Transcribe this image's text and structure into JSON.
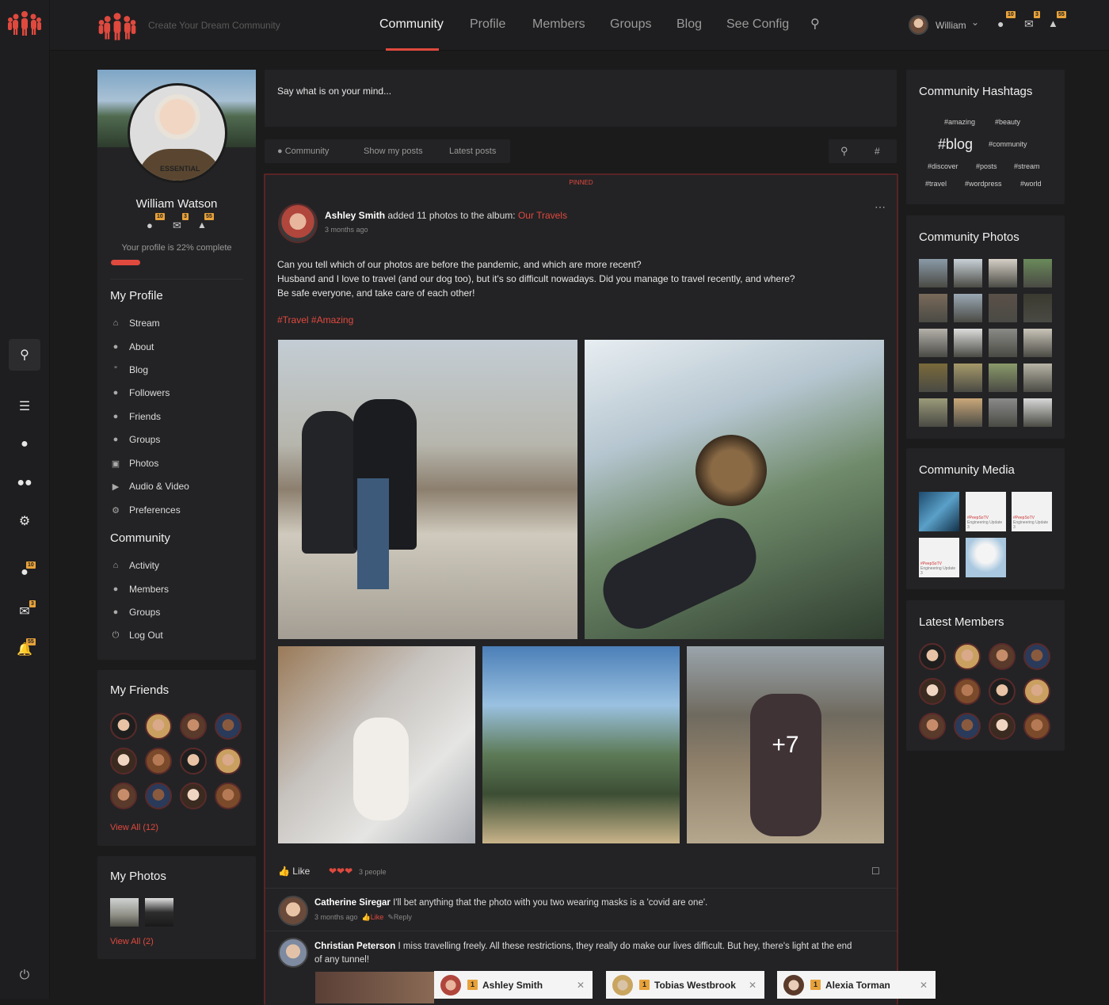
{
  "brand": {
    "tagline": "Create Your Dream Community"
  },
  "nav": [
    "Community",
    "Profile",
    "Members",
    "Groups",
    "Blog",
    "See Config"
  ],
  "user": {
    "name": "William",
    "badges": [
      "10",
      "3",
      "55"
    ]
  },
  "profile": {
    "name": "William Watson",
    "badges": [
      "10",
      "3",
      "55"
    ],
    "complete_text": "Your profile is 22% complete",
    "complete_pct": 22,
    "shirt_text": "ESSENTIAL"
  },
  "my_profile": {
    "title": "My Profile",
    "items": [
      "Stream",
      "About",
      "Blog",
      "Followers",
      "Friends",
      "Groups",
      "Photos",
      "Audio & Video",
      "Preferences"
    ]
  },
  "community_menu": {
    "title": "Community",
    "items": [
      "Activity",
      "Members",
      "Groups",
      "Log Out"
    ]
  },
  "friends": {
    "title": "My Friends",
    "view_all": "View All (12)"
  },
  "photos": {
    "title": "My Photos",
    "view_all": "View All (2)"
  },
  "composer": {
    "placeholder": "Say what is on your mind..."
  },
  "filters": {
    "community": "Community",
    "mine": "Show my posts",
    "latest": "Latest posts",
    "hash": "#"
  },
  "post": {
    "pinned": "PINNED",
    "author": "Ashley Smith",
    "action": "added 11 photos to the album:",
    "album": "Our Travels",
    "time": "3 months ago",
    "lines": [
      "Can you tell which of our photos are before the pandemic, and which are more recent?",
      "Husband and I love to travel (and our dog too), but it's so difficult nowadays. Did you manage to travel recently, and where?",
      "Be safe everyone, and take care of each other!"
    ],
    "tags": "#Travel #Amazing",
    "more": "+7",
    "like": "Like",
    "people": "3 people"
  },
  "comments": [
    {
      "author": "Catherine Siregar",
      "text": "I'll bet anything that the photo with you two wearing masks is a 'covid are one'.",
      "time": "3 months ago",
      "like": "Like",
      "reply": "Reply"
    },
    {
      "author": "Christian Peterson",
      "text": "I miss travelling freely. All these restrictions, they really do make our lives difficult. But hey, there's light at the end",
      "text2": "of any tunnel!"
    }
  ],
  "hashtags": {
    "title": "Community Hashtags",
    "items": [
      "#amazing",
      "#beauty",
      "#blog",
      "#community",
      "#discover",
      "#posts",
      "#stream",
      "#travel",
      "#wordpress",
      "#world"
    ]
  },
  "cphotos": {
    "title": "Community Photos"
  },
  "cmedia": {
    "title": "Community Media",
    "thumb_text": "#PeepSoTV",
    "thumb_sub": "Engineering Update 3"
  },
  "members": {
    "title": "Latest Members"
  },
  "chats": [
    {
      "name": "Ashley Smith",
      "badge": "1"
    },
    {
      "name": "Tobias Westbrook",
      "badge": "1"
    },
    {
      "name": "Alexia Torman",
      "badge": "1"
    }
  ],
  "colors": {
    "accent": "#e0493e",
    "bg": "#1b1b1c",
    "card": "#232325"
  }
}
